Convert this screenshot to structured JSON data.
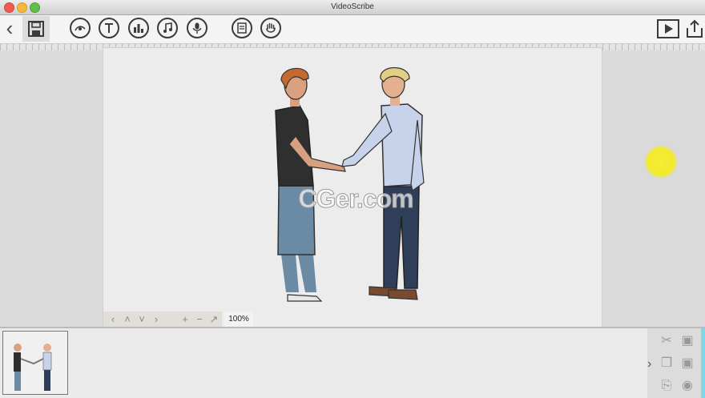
{
  "window": {
    "title": "VideoScribe"
  },
  "toolbar": {
    "icons": [
      "back-icon",
      "save-icon",
      "image-icon",
      "text-icon",
      "chart-icon",
      "music-icon",
      "microphone-icon",
      "document-icon",
      "hand-icon",
      "play-icon",
      "export-icon"
    ]
  },
  "canvas": {
    "zoom_label": "100%",
    "watermark": "CGer.com"
  },
  "timeline": {
    "tools": [
      "cut-icon",
      "copy-icon",
      "paste-icon",
      "camera-icon",
      "camera-set-icon",
      "eye-icon"
    ]
  },
  "colors": {
    "accent": "#7fd5ea",
    "cursor": "#f3ea2a"
  }
}
